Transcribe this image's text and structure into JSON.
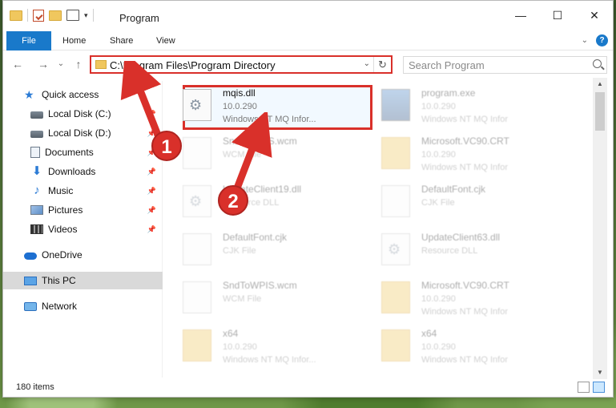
{
  "window": {
    "title": "Program",
    "controls": {
      "minimize": "—",
      "maximize": "☐",
      "close": "✕"
    }
  },
  "ribbon": {
    "tabs": [
      "File",
      "Home",
      "Share",
      "View"
    ],
    "help": "?"
  },
  "nav": {
    "back": "←",
    "forward": "→",
    "recent": "⌄",
    "up": "↑",
    "address": "C:\\Program Files\\Program Directory",
    "search_placeholder": "Search Program",
    "refresh": "↻"
  },
  "sidebar": {
    "items": [
      {
        "label": "Quick access",
        "icon": "star-icon"
      },
      {
        "label": "Local Disk (C:)",
        "icon": "disk-icon",
        "pinned": true
      },
      {
        "label": "Local Disk (D:)",
        "icon": "disk-icon",
        "pinned": true
      },
      {
        "label": "Documents",
        "icon": "document-icon",
        "pinned": true
      },
      {
        "label": "Downloads",
        "icon": "download-icon",
        "pinned": true
      },
      {
        "label": "Music",
        "icon": "music-icon",
        "pinned": true
      },
      {
        "label": "Pictures",
        "icon": "pictures-icon",
        "pinned": true
      },
      {
        "label": "Videos",
        "icon": "videos-icon",
        "pinned": true
      },
      {
        "label": "OneDrive",
        "icon": "cloud-icon"
      },
      {
        "label": "This PC",
        "icon": "computer-icon",
        "selected": true
      },
      {
        "label": "Network",
        "icon": "network-icon"
      }
    ]
  },
  "files": [
    {
      "name": "mqis.dll",
      "line2": "10.0.290",
      "line3": "Windows NT MQ Infor...",
      "type": "dll",
      "highlighted": true
    },
    {
      "name": "program.exe",
      "line2": "10.0.290",
      "line3": "Windows NT MQ Infor",
      "type": "exe"
    },
    {
      "name": "SndToWPIS.wcm",
      "line2": "WCM File",
      "line3": "",
      "type": "doc"
    },
    {
      "name": "Microsoft.VC90.CRT",
      "line2": "10.0.290",
      "line3": "Windows NT MQ Infor",
      "type": "folder"
    },
    {
      "name": "UpdateClient19.dll",
      "line2": "Resource DLL",
      "line3": "",
      "type": "dll"
    },
    {
      "name": "DefaultFont.cjk",
      "line2": "CJK File",
      "line3": "",
      "type": "doc"
    },
    {
      "name": "DefaultFont.cjk",
      "line2": "CJK File",
      "line3": "",
      "type": "doc"
    },
    {
      "name": "UpdateClient63.dll",
      "line2": "Resource DLL",
      "line3": "",
      "type": "dll"
    },
    {
      "name": "SndToWPIS.wcm",
      "line2": "WCM File",
      "line3": "",
      "type": "doc"
    },
    {
      "name": "Microsoft.VC90.CRT",
      "line2": "10.0.290",
      "line3": "Windows NT MQ Infor",
      "type": "folder"
    },
    {
      "name": "x64",
      "line2": "10.0.290",
      "line3": "Windows NT MQ Infor...",
      "type": "folder"
    },
    {
      "name": "x64",
      "line2": "10.0.290",
      "line3": "Windows NT MQ Infor",
      "type": "folder"
    }
  ],
  "status": {
    "count": "180 items"
  },
  "annotations": {
    "step1": "1",
    "step2": "2",
    "accent": "#d9302a"
  }
}
